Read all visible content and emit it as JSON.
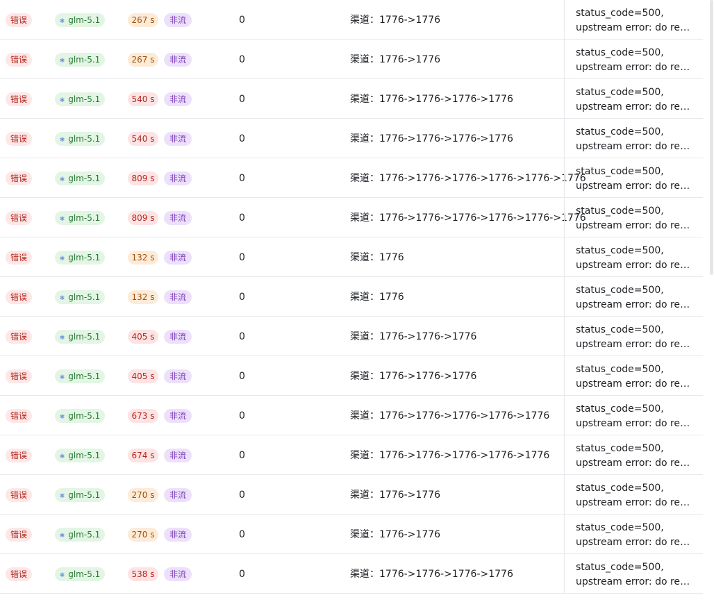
{
  "rows": [
    {
      "status": "错误",
      "model": "glm-5.1",
      "time": "267 s",
      "tone": "low",
      "stream": "非流",
      "cost": "0",
      "channel": "渠道：1776->1776",
      "error_line1": "status_code=500,",
      "error_line2": "upstream error: do request failed"
    },
    {
      "status": "错误",
      "model": "glm-5.1",
      "time": "267 s",
      "tone": "low",
      "stream": "非流",
      "cost": "0",
      "channel": "渠道：1776->1776",
      "error_line1": "status_code=500,",
      "error_line2": "upstream error: do request failed"
    },
    {
      "status": "错误",
      "model": "glm-5.1",
      "time": "540 s",
      "tone": "high",
      "stream": "非流",
      "cost": "0",
      "channel": "渠道：1776->1776->1776->1776",
      "error_line1": "status_code=500,",
      "error_line2": "upstream error: do request failed"
    },
    {
      "status": "错误",
      "model": "glm-5.1",
      "time": "540 s",
      "tone": "high",
      "stream": "非流",
      "cost": "0",
      "channel": "渠道：1776->1776->1776->1776",
      "error_line1": "status_code=500,",
      "error_line2": "upstream error: do request failed"
    },
    {
      "status": "错误",
      "model": "glm-5.1",
      "time": "809 s",
      "tone": "high",
      "stream": "非流",
      "cost": "0",
      "channel": "渠道：1776->1776->1776->1776->1776->1776",
      "error_line1": "status_code=500,",
      "error_line2": "upstream error: do request failed"
    },
    {
      "status": "错误",
      "model": "glm-5.1",
      "time": "809 s",
      "tone": "high",
      "stream": "非流",
      "cost": "0",
      "channel": "渠道：1776->1776->1776->1776->1776->1776",
      "error_line1": "status_code=500,",
      "error_line2": "upstream error: do request failed"
    },
    {
      "status": "错误",
      "model": "glm-5.1",
      "time": "132 s",
      "tone": "low",
      "stream": "非流",
      "cost": "0",
      "channel": "渠道：1776",
      "error_line1": "status_code=500,",
      "error_line2": "upstream error: do request failed"
    },
    {
      "status": "错误",
      "model": "glm-5.1",
      "time": "132 s",
      "tone": "low",
      "stream": "非流",
      "cost": "0",
      "channel": "渠道：1776",
      "error_line1": "status_code=500,",
      "error_line2": "upstream error: do request failed"
    },
    {
      "status": "错误",
      "model": "glm-5.1",
      "time": "405 s",
      "tone": "high",
      "stream": "非流",
      "cost": "0",
      "channel": "渠道：1776->1776->1776",
      "error_line1": "status_code=500,",
      "error_line2": "upstream error: do request failed"
    },
    {
      "status": "错误",
      "model": "glm-5.1",
      "time": "405 s",
      "tone": "high",
      "stream": "非流",
      "cost": "0",
      "channel": "渠道：1776->1776->1776",
      "error_line1": "status_code=500,",
      "error_line2": "upstream error: do request failed"
    },
    {
      "status": "错误",
      "model": "glm-5.1",
      "time": "673 s",
      "tone": "high",
      "stream": "非流",
      "cost": "0",
      "channel": "渠道：1776->1776->1776->1776->1776",
      "error_line1": "status_code=500,",
      "error_line2": "upstream error: do request failed"
    },
    {
      "status": "错误",
      "model": "glm-5.1",
      "time": "674 s",
      "tone": "high",
      "stream": "非流",
      "cost": "0",
      "channel": "渠道：1776->1776->1776->1776->1776",
      "error_line1": "status_code=500,",
      "error_line2": "upstream error: do request failed"
    },
    {
      "status": "错误",
      "model": "glm-5.1",
      "time": "270 s",
      "tone": "low",
      "stream": "非流",
      "cost": "0",
      "channel": "渠道：1776->1776",
      "error_line1": "status_code=500,",
      "error_line2": "upstream error: do request failed"
    },
    {
      "status": "错误",
      "model": "glm-5.1",
      "time": "270 s",
      "tone": "low",
      "stream": "非流",
      "cost": "0",
      "channel": "渠道：1776->1776",
      "error_line1": "status_code=500,",
      "error_line2": "upstream error: do request failed"
    },
    {
      "status": "错误",
      "model": "glm-5.1",
      "time": "538 s",
      "tone": "high",
      "stream": "非流",
      "cost": "0",
      "channel": "渠道：1776->1776->1776->1776",
      "error_line1": "status_code=500,",
      "error_line2": "upstream error: do request failed"
    }
  ],
  "icons": {
    "model_icon": "model-logo-icon"
  },
  "colors": {
    "status_error_bg": "#fde7e7",
    "model_tag_bg": "#e3f5e4",
    "time_low_bg": "#fdebd7",
    "time_high_bg": "#fde3e3",
    "stream_tag_bg": "#ede0fa"
  }
}
